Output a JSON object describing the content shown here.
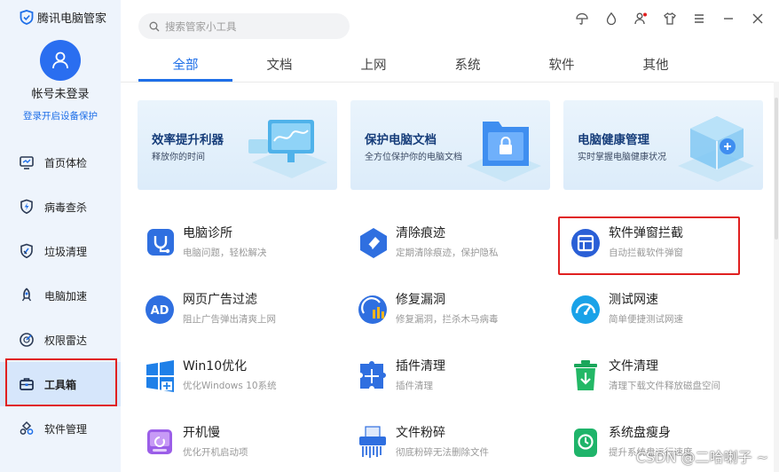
{
  "sidebar": {
    "brand": "腾讯电脑管家",
    "account_name": "帐号未登录",
    "login_link": "登录开启设备保护",
    "items": [
      {
        "label": "首页体检",
        "icon": "screen-icon"
      },
      {
        "label": "病毒查杀",
        "icon": "shield-bolt-icon"
      },
      {
        "label": "垃圾清理",
        "icon": "broom-icon"
      },
      {
        "label": "电脑加速",
        "icon": "rocket-icon"
      },
      {
        "label": "权限雷达",
        "icon": "radar-icon"
      },
      {
        "label": "工具箱",
        "icon": "toolbox-icon",
        "active": true
      },
      {
        "label": "软件管理",
        "icon": "apps-icon"
      }
    ]
  },
  "search": {
    "placeholder": "搜索管家小工具"
  },
  "tabs": [
    "全部",
    "文档",
    "上网",
    "系统",
    "软件",
    "其他"
  ],
  "active_tab": "全部",
  "banners": [
    {
      "title": "效率提升利器",
      "subtitle": "释放你的时间"
    },
    {
      "title": "保护电脑文档",
      "subtitle": "全方位保护你的电脑文档"
    },
    {
      "title": "电脑健康管理",
      "subtitle": "实时掌握电脑健康状况"
    }
  ],
  "tools": [
    {
      "name": "电脑诊所",
      "desc": "电脑问题，轻松解决",
      "icon": "stethoscope-icon"
    },
    {
      "name": "清除痕迹",
      "desc": "定期清除痕迹，保护隐私",
      "icon": "eraser-icon"
    },
    {
      "name": "软件弹窗拦截",
      "desc": "自动拦截软件弹窗",
      "icon": "popup-block-icon"
    },
    {
      "name": "网页广告过滤",
      "desc": "阻止广告弹出清爽上网",
      "icon": "ad-block-icon"
    },
    {
      "name": "修复漏洞",
      "desc": "修复漏洞，拦杀木马病毒",
      "icon": "patch-icon"
    },
    {
      "name": "测试网速",
      "desc": "简单便捷测试网速",
      "icon": "speedometer-icon"
    },
    {
      "name": "Win10优化",
      "desc": "优化Windows 10系统",
      "icon": "windows-icon"
    },
    {
      "name": "插件清理",
      "desc": "插件清理",
      "icon": "puzzle-icon"
    },
    {
      "name": "文件清理",
      "desc": "清理下载文件释放磁盘空间",
      "icon": "trash-icon"
    },
    {
      "name": "开机慢",
      "desc": "优化开机启动项",
      "icon": "boot-icon"
    },
    {
      "name": "文件粉碎",
      "desc": "彻底粉碎无法删除文件",
      "icon": "shredder-icon"
    },
    {
      "name": "系统盘瘦身",
      "desc": "提升系统盘运行速度",
      "icon": "disk-slim-icon"
    }
  ],
  "watermark": "CSDN @二哈喇子 ~",
  "colors": {
    "accent": "#1e6fe8",
    "highlight": "#e02020"
  }
}
